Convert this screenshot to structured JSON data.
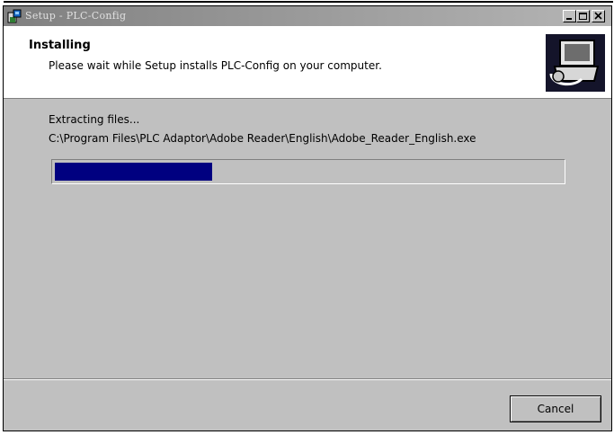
{
  "window": {
    "title": "Setup - PLC-Config",
    "controls": [
      "minimize-icon",
      "maximize-icon",
      "close-icon"
    ]
  },
  "header": {
    "title": "Installing",
    "subtitle": "Please wait while Setup installs PLC-Config on your computer.",
    "image_icon": "setup-computer-icon"
  },
  "body": {
    "status": "Extracting files...",
    "current_file": "C:\\Program Files\\PLC Adaptor\\Adobe Reader\\English\\Adobe_Reader_English.exe",
    "progress_fraction": 0.31
  },
  "footer": {
    "cancel_label": "Cancel"
  }
}
